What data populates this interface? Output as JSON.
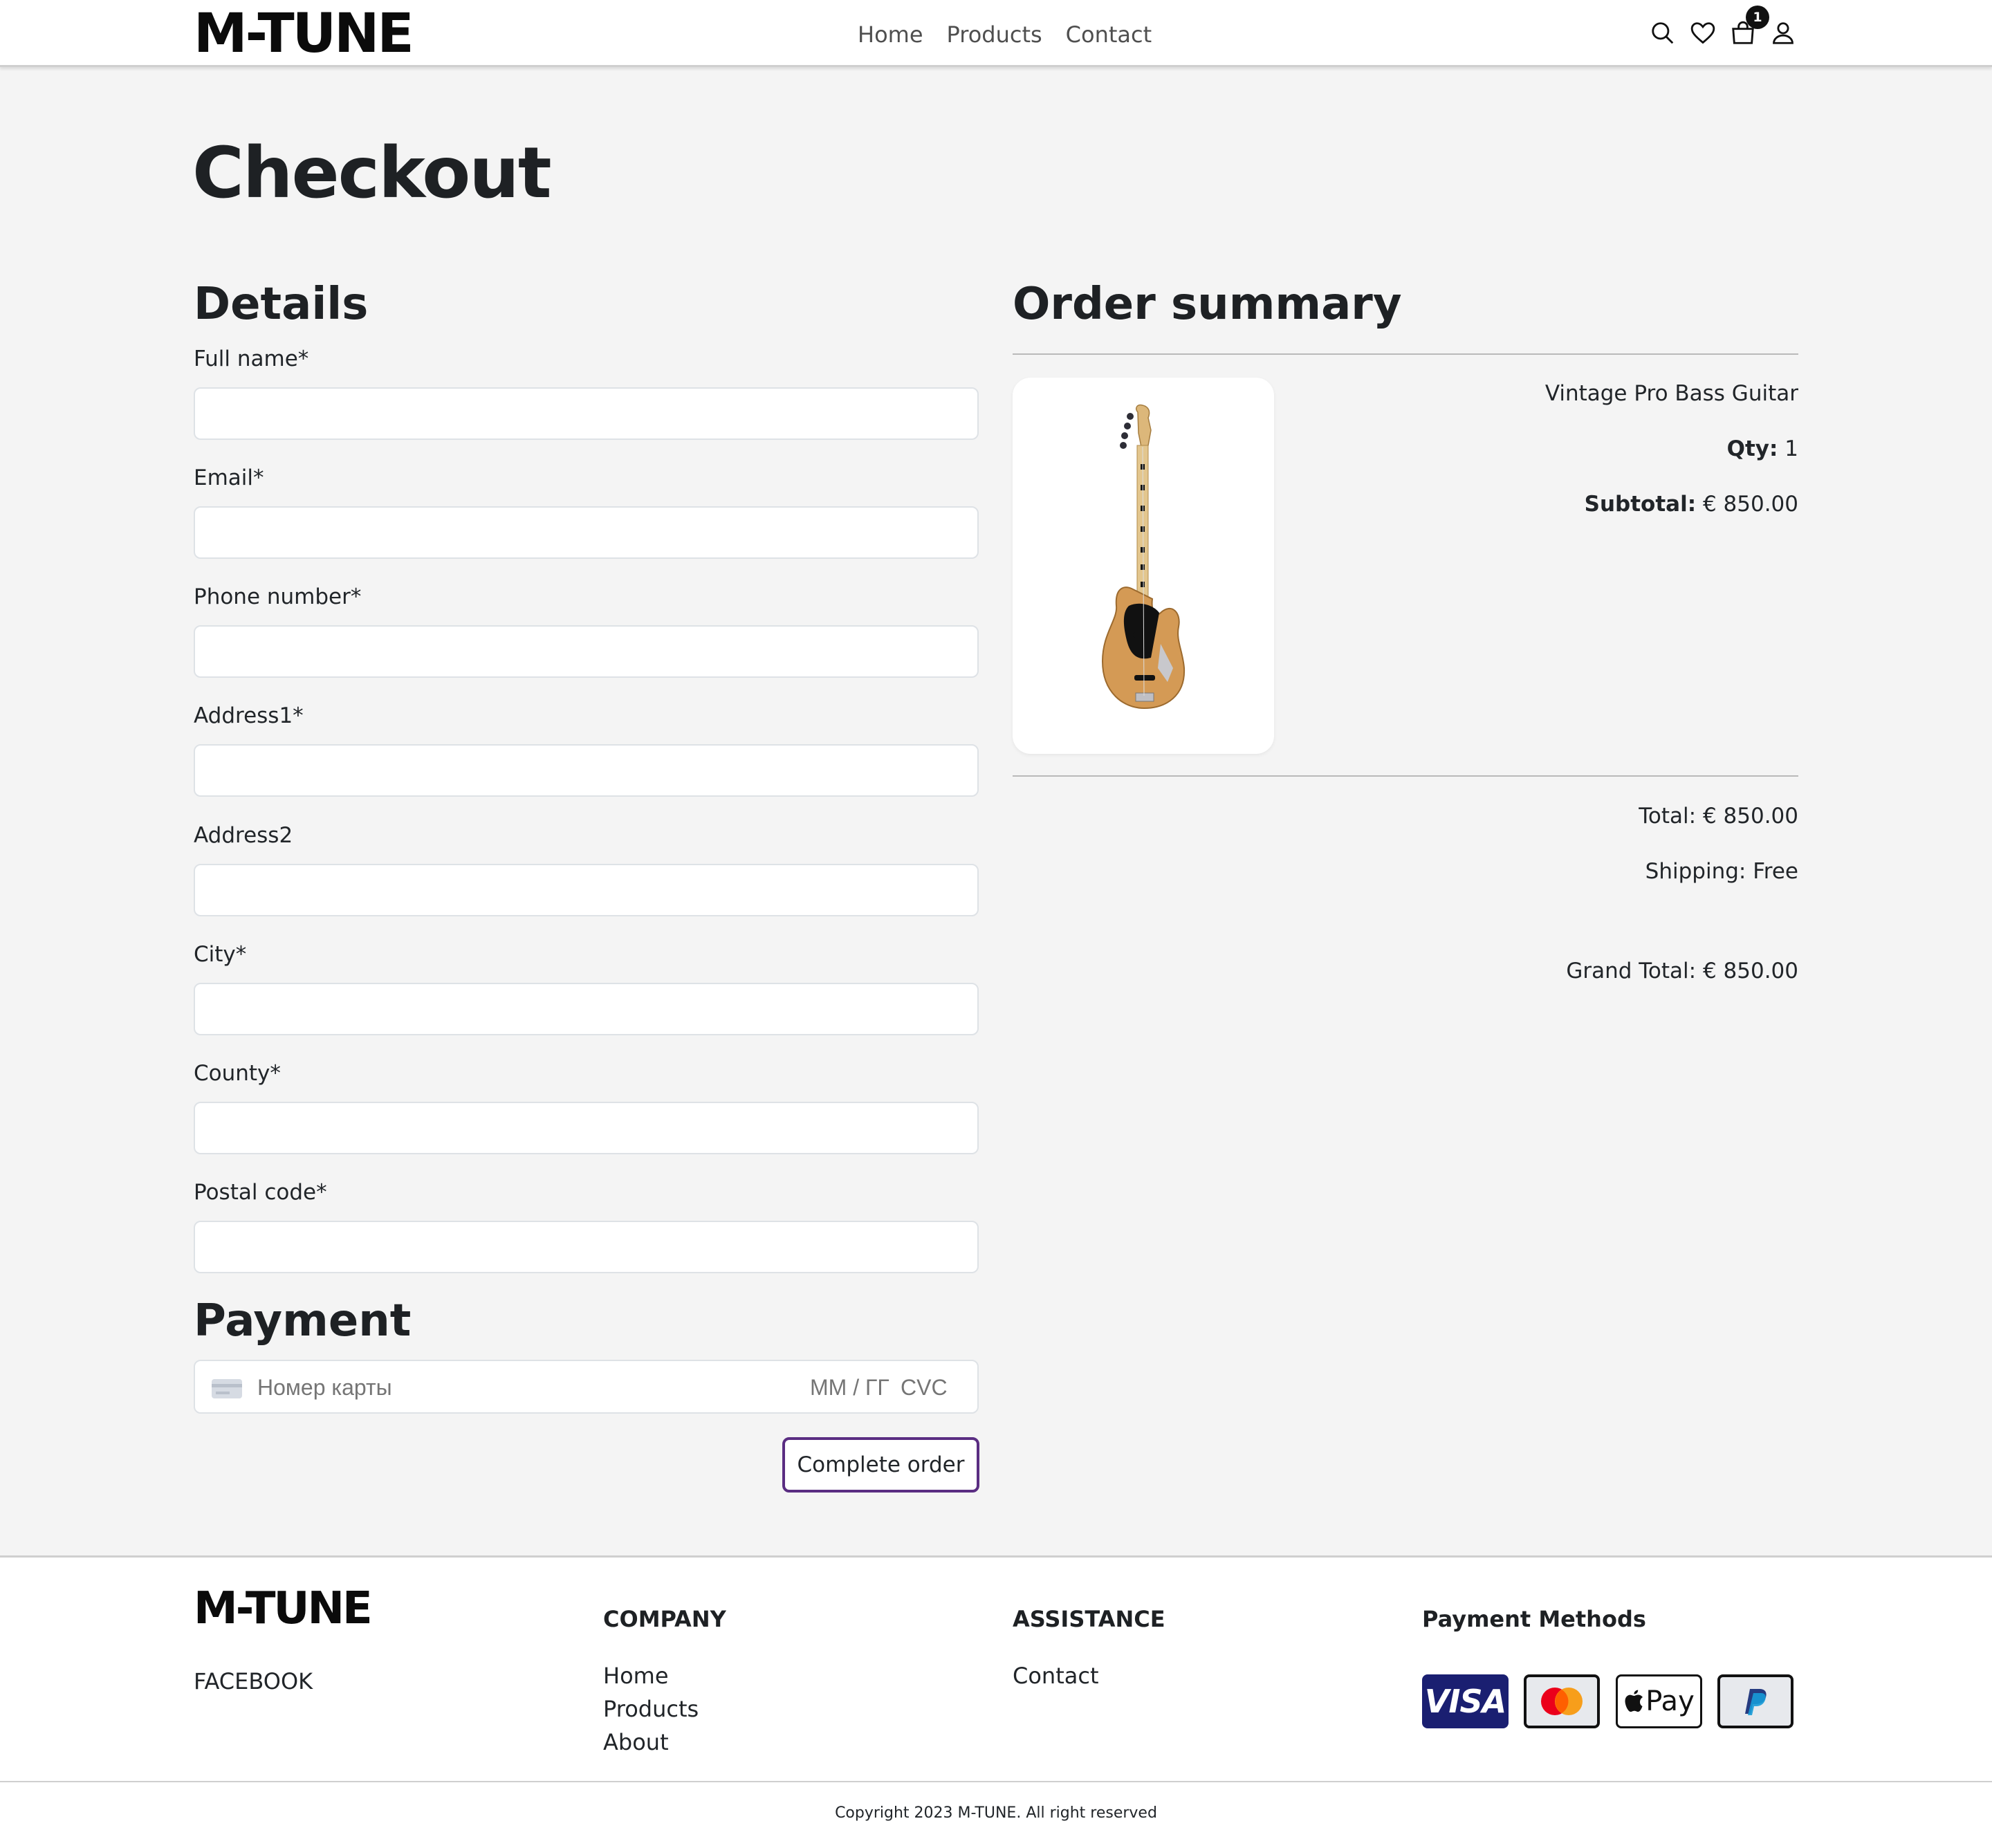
{
  "header": {
    "logo": "M-TUNE",
    "nav": [
      "Home",
      "Products",
      "Contact"
    ],
    "cart_count": "1",
    "icons": [
      "search-icon",
      "heart-icon",
      "bag-icon",
      "user-icon"
    ]
  },
  "main": {
    "title": "Checkout",
    "details": {
      "heading": "Details",
      "fields": [
        {
          "label": "Full name*",
          "value": ""
        },
        {
          "label": "Email*",
          "value": ""
        },
        {
          "label": "Phone number*",
          "value": ""
        },
        {
          "label": "Address1*",
          "value": ""
        },
        {
          "label": "Address2",
          "value": ""
        },
        {
          "label": "City*",
          "value": ""
        },
        {
          "label": "County*",
          "value": ""
        },
        {
          "label": "Postal code*",
          "value": ""
        }
      ]
    },
    "payment": {
      "heading": "Payment",
      "card_placeholder": "Номер карты",
      "expiry_placeholder": "ММ / ГГ",
      "cvc_placeholder": "CVC",
      "submit_label": "Complete order"
    },
    "summary": {
      "heading": "Order summary",
      "item": {
        "name": "Vintage Pro Bass Guitar",
        "qty_label": "Qty:",
        "qty": "1",
        "subtotal_label": "Subtotal:",
        "subtotal": "€ 850.00"
      },
      "total": "Total: € 850.00",
      "shipping": "Shipping: Free",
      "grand_total": "Grand Total: € 850.00"
    }
  },
  "footer": {
    "logo": "M-TUNE",
    "social": "FACEBOOK",
    "company": {
      "heading": "COMPANY",
      "links": [
        "Home",
        "Products",
        "About"
      ]
    },
    "assistance": {
      "heading": "ASSISTANCE",
      "links": [
        "Contact"
      ]
    },
    "payment_methods": {
      "heading": "Payment Methods",
      "visa": "VISA",
      "apple_pay": "Pay"
    },
    "copyright": "Copyright 2023 M-TUNE. All right reserved"
  },
  "colors": {
    "accent": "#5a2d82",
    "background": "#f4f4f4",
    "visa_blue": "#1a1f71"
  }
}
